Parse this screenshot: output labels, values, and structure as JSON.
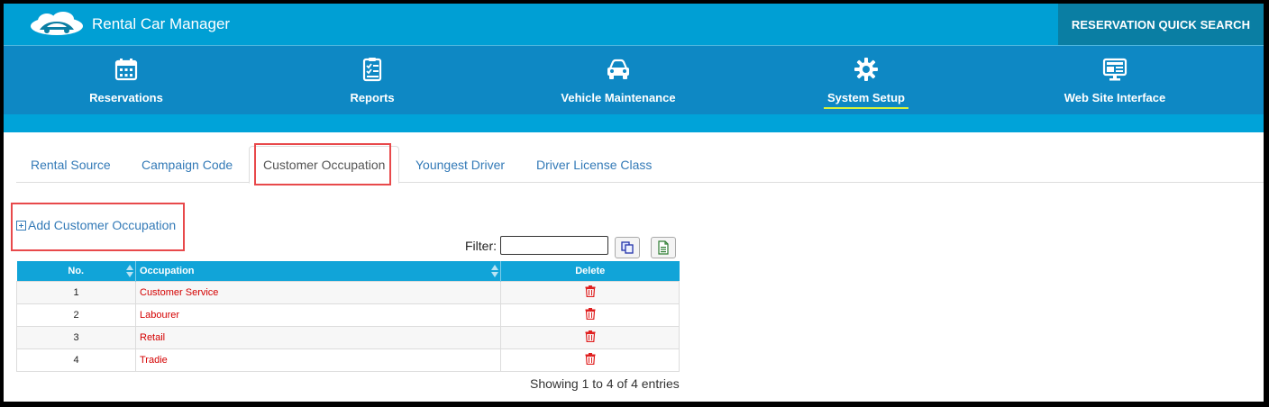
{
  "app": {
    "title": "Rental Car Manager",
    "quick_search": "RESERVATION QUICK SEARCH"
  },
  "nav": {
    "items": [
      {
        "label": "Reservations",
        "icon": "calendar-icon"
      },
      {
        "label": "Reports",
        "icon": "checklist-icon"
      },
      {
        "label": "Vehicle Maintenance",
        "icon": "car-icon"
      },
      {
        "label": "System Setup",
        "icon": "gear-icon",
        "active": true
      },
      {
        "label": "Web Site Interface",
        "icon": "monitor-icon"
      }
    ]
  },
  "tabs": [
    {
      "label": "Rental Source"
    },
    {
      "label": "Campaign Code"
    },
    {
      "label": "Customer Occupation",
      "active": true
    },
    {
      "label": "Youngest Driver"
    },
    {
      "label": "Driver License Class"
    }
  ],
  "actions": {
    "add_label": "Add Customer Occupation"
  },
  "filter": {
    "label": "Filter:",
    "value": ""
  },
  "table": {
    "columns": [
      "No.",
      "Occupation",
      "Delete"
    ],
    "rows": [
      {
        "no": "1",
        "occupation": "Customer Service"
      },
      {
        "no": "2",
        "occupation": "Labourer"
      },
      {
        "no": "3",
        "occupation": "Retail"
      },
      {
        "no": "4",
        "occupation": "Tradie"
      }
    ],
    "info": "Showing 1 to 4 of 4 entries"
  },
  "colors": {
    "header_bg": "#009fd4",
    "nav_bg": "#0e88c4",
    "table_header": "#11a4d8",
    "link": "#337ab7",
    "occupation_text": "#d40000",
    "highlight": "#e8494b",
    "active_underline": "#d7f23a"
  }
}
